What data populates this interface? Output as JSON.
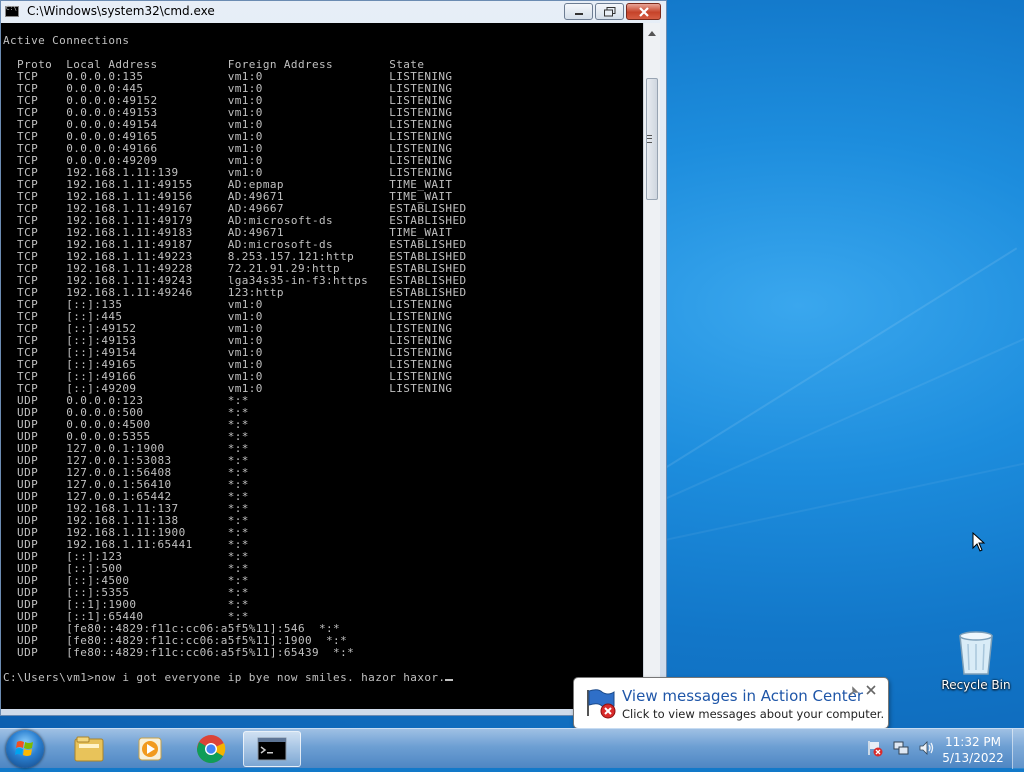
{
  "window": {
    "title": "C:\\Windows\\system32\\cmd.exe"
  },
  "console": {
    "heading": "Active Connections",
    "columns": [
      "Proto",
      "Local Address",
      "Foreign Address",
      "State"
    ],
    "rows": [
      [
        "TCP",
        "0.0.0.0:135",
        "vm1:0",
        "LISTENING"
      ],
      [
        "TCP",
        "0.0.0.0:445",
        "vm1:0",
        "LISTENING"
      ],
      [
        "TCP",
        "0.0.0.0:49152",
        "vm1:0",
        "LISTENING"
      ],
      [
        "TCP",
        "0.0.0.0:49153",
        "vm1:0",
        "LISTENING"
      ],
      [
        "TCP",
        "0.0.0.0:49154",
        "vm1:0",
        "LISTENING"
      ],
      [
        "TCP",
        "0.0.0.0:49165",
        "vm1:0",
        "LISTENING"
      ],
      [
        "TCP",
        "0.0.0.0:49166",
        "vm1:0",
        "LISTENING"
      ],
      [
        "TCP",
        "0.0.0.0:49209",
        "vm1:0",
        "LISTENING"
      ],
      [
        "TCP",
        "192.168.1.11:139",
        "vm1:0",
        "LISTENING"
      ],
      [
        "TCP",
        "192.168.1.11:49155",
        "AD:epmap",
        "TIME_WAIT"
      ],
      [
        "TCP",
        "192.168.1.11:49156",
        "AD:49671",
        "TIME_WAIT"
      ],
      [
        "TCP",
        "192.168.1.11:49167",
        "AD:49667",
        "ESTABLISHED"
      ],
      [
        "TCP",
        "192.168.1.11:49179",
        "AD:microsoft-ds",
        "ESTABLISHED"
      ],
      [
        "TCP",
        "192.168.1.11:49183",
        "AD:49671",
        "TIME_WAIT"
      ],
      [
        "TCP",
        "192.168.1.11:49187",
        "AD:microsoft-ds",
        "ESTABLISHED"
      ],
      [
        "TCP",
        "192.168.1.11:49223",
        "8.253.157.121:http",
        "ESTABLISHED"
      ],
      [
        "TCP",
        "192.168.1.11:49228",
        "72.21.91.29:http",
        "ESTABLISHED"
      ],
      [
        "TCP",
        "192.168.1.11:49243",
        "lga34s35-in-f3:https",
        "ESTABLISHED"
      ],
      [
        "TCP",
        "192.168.1.11:49246",
        "123:http",
        "ESTABLISHED"
      ],
      [
        "TCP",
        "[::]:135",
        "vm1:0",
        "LISTENING"
      ],
      [
        "TCP",
        "[::]:445",
        "vm1:0",
        "LISTENING"
      ],
      [
        "TCP",
        "[::]:49152",
        "vm1:0",
        "LISTENING"
      ],
      [
        "TCP",
        "[::]:49153",
        "vm1:0",
        "LISTENING"
      ],
      [
        "TCP",
        "[::]:49154",
        "vm1:0",
        "LISTENING"
      ],
      [
        "TCP",
        "[::]:49165",
        "vm1:0",
        "LISTENING"
      ],
      [
        "TCP",
        "[::]:49166",
        "vm1:0",
        "LISTENING"
      ],
      [
        "TCP",
        "[::]:49209",
        "vm1:0",
        "LISTENING"
      ],
      [
        "UDP",
        "0.0.0.0:123",
        "*:*",
        ""
      ],
      [
        "UDP",
        "0.0.0.0:500",
        "*:*",
        ""
      ],
      [
        "UDP",
        "0.0.0.0:4500",
        "*:*",
        ""
      ],
      [
        "UDP",
        "0.0.0.0:5355",
        "*:*",
        ""
      ],
      [
        "UDP",
        "127.0.0.1:1900",
        "*:*",
        ""
      ],
      [
        "UDP",
        "127.0.0.1:53083",
        "*:*",
        ""
      ],
      [
        "UDP",
        "127.0.0.1:56408",
        "*:*",
        ""
      ],
      [
        "UDP",
        "127.0.0.1:56410",
        "*:*",
        ""
      ],
      [
        "UDP",
        "127.0.0.1:65442",
        "*:*",
        ""
      ],
      [
        "UDP",
        "192.168.1.11:137",
        "*:*",
        ""
      ],
      [
        "UDP",
        "192.168.1.11:138",
        "*:*",
        ""
      ],
      [
        "UDP",
        "192.168.1.11:1900",
        "*:*",
        ""
      ],
      [
        "UDP",
        "192.168.1.11:65441",
        "*:*",
        ""
      ],
      [
        "UDP",
        "[::]:123",
        "*:*",
        ""
      ],
      [
        "UDP",
        "[::]:500",
        "*:*",
        ""
      ],
      [
        "UDP",
        "[::]:4500",
        "*:*",
        ""
      ],
      [
        "UDP",
        "[::]:5355",
        "*:*",
        ""
      ],
      [
        "UDP",
        "[::1]:1900",
        "*:*",
        ""
      ],
      [
        "UDP",
        "[::1]:65440",
        "*:*",
        ""
      ],
      [
        "UDP",
        "[fe80::4829:f11c:cc06:a5f5%11]:546",
        "*:*",
        ""
      ],
      [
        "UDP",
        "[fe80::4829:f11c:cc06:a5f5%11]:1900",
        "*:*",
        ""
      ],
      [
        "UDP",
        "[fe80::4829:f11c:cc06:a5f5%11]:65439",
        "*:*",
        ""
      ]
    ],
    "prompt": "C:\\Users\\vm1>now i got everyone ip bye now smiles. hazor haxor."
  },
  "notification": {
    "title": "View messages in Action Center",
    "body": "Click to view messages about your computer."
  },
  "desktop": {
    "recycle_bin_label": "Recycle Bin"
  },
  "clock": {
    "time": "11:32 PM",
    "date": "5/13/2022"
  },
  "icons": {
    "taskbar": [
      "windows-explorer-icon",
      "media-player-icon",
      "chrome-icon",
      "cmd-icon"
    ],
    "tray": [
      "action-center-warning-icon",
      "network-icon",
      "volume-icon"
    ]
  }
}
